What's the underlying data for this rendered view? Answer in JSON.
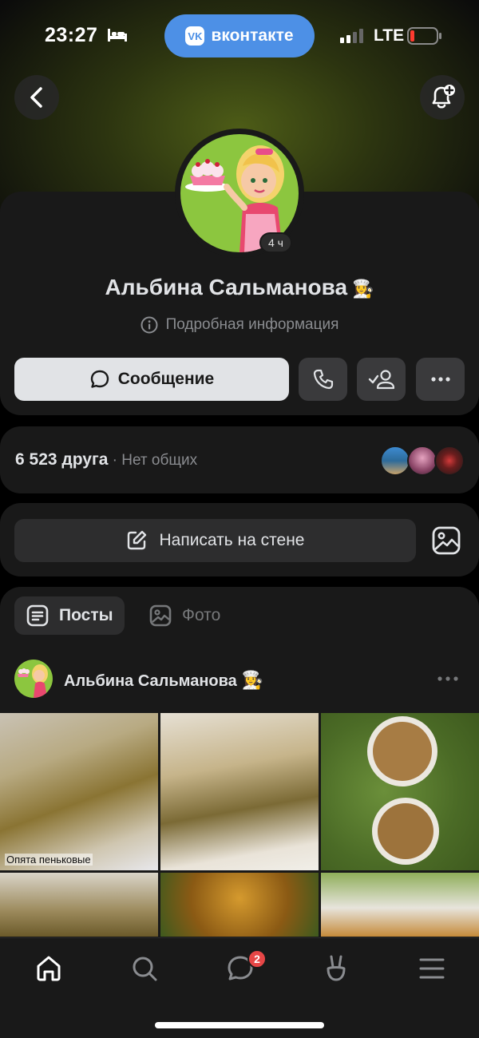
{
  "status_bar": {
    "time": "23:27",
    "app_pill": "вконтакте",
    "app_logo": "VK",
    "network": "LTE"
  },
  "profile": {
    "online_badge": "4 ч",
    "name": "Альбина Сальманова",
    "name_emoji": "👩‍🍳",
    "details_link": "Подробная информация",
    "message_button": "Сообщение"
  },
  "friends": {
    "count": "6 523 друга",
    "mutual": " · Нет общих"
  },
  "wall": {
    "write_button": "Написать на стене"
  },
  "tabs": {
    "posts": "Посты",
    "photos": "Фото"
  },
  "post": {
    "author": "Альбина Сальманова",
    "author_emoji": "👩‍🍳",
    "photo_caption": "Опята пеньковые"
  },
  "tab_bar": {
    "messages_badge": "2"
  },
  "colors": {
    "vk_blue": "#4d90e6",
    "card_bg": "#191919",
    "badge_red": "#e64646",
    "avatar_green": "#8cc63f"
  }
}
